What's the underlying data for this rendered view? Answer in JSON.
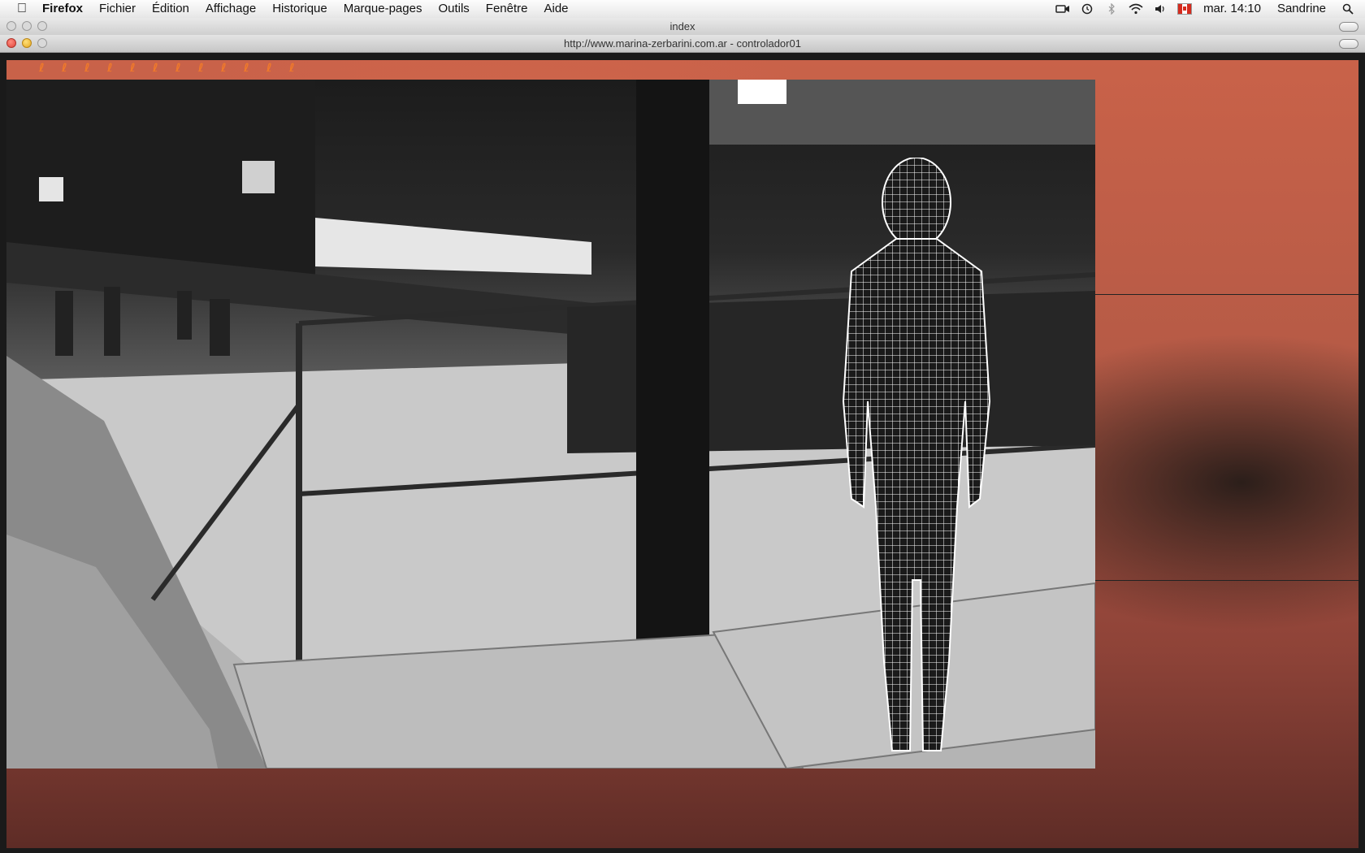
{
  "menubar": {
    "app_name": "Firefox",
    "items": [
      "Fichier",
      "Édition",
      "Affichage",
      "Historique",
      "Marque-pages",
      "Outils",
      "Fenêtre",
      "Aide"
    ],
    "clock": "mar. 14:10",
    "user": "Sandrine",
    "status_icons": [
      "camera-icon",
      "time-machine-icon",
      "bluetooth-icon",
      "wifi-icon",
      "volume-icon",
      "canada-flag-icon",
      "spotlight-icon"
    ]
  },
  "window": {
    "app_title": "index",
    "page_title": "http://www.marina-zerbarini.com.ar - controlador01"
  },
  "page": {
    "loader_glyph": "ℓ",
    "colors": {
      "accent": "#f07a2a",
      "background": "#b55a46"
    }
  }
}
